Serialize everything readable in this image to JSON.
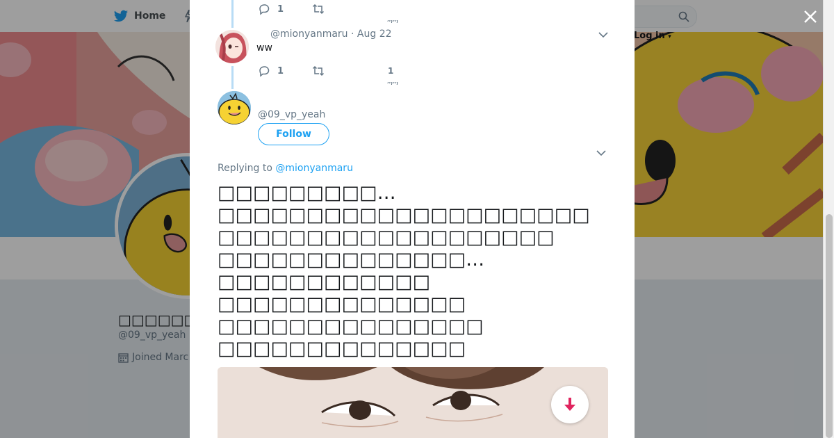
{
  "topnav": {
    "home_label": "Home",
    "login_label": "Log in"
  },
  "profile": {
    "name": "□□□□□□",
    "handle": "@09_vp_yeah",
    "joined": "Joined Marc"
  },
  "thread": {
    "prev_tweet": {
      "reply_count": "1",
      "cut_glyph": "ጣጣ"
    },
    "mionyan_tweet": {
      "handle": "@mionyanmaru",
      "separator": "·",
      "date": "Aug 22",
      "text": "ww",
      "reply_count": "1",
      "like_count": "1",
      "cut_glyph": "ጣጣ"
    },
    "main_tweet": {
      "handle": "@09_vp_yeah",
      "follow_label": "Follow",
      "replying_to_label": "Replying to",
      "replying_to_handle": "@mionyanmaru",
      "lines": [
        "□□□□□□□□□…",
        "□□□□□□□□□□□□□□□□□□□□□",
        "□□□□□□□□□□□□□□□□□□□",
        "□□□□□□□□□□□□□□…",
        "□□□□□□□□□□□□",
        "□□□□□□□□□□□□□□",
        "□□□□□□□□□□□□□□□",
        "□□□□□□□□□□□□□□"
      ]
    }
  },
  "icons": {
    "twitter_bird": "twitter-bird-icon",
    "search": "search-icon",
    "close": "close-icon",
    "reply": "reply-icon",
    "retweet": "retweet-icon",
    "chevron": "chevron-down-icon",
    "download": "download-icon",
    "calendar": "calendar-icon"
  },
  "colors": {
    "accent": "#1da1f2",
    "thread_line": "#b8dcf5",
    "download_arrow": "#e0245e"
  }
}
